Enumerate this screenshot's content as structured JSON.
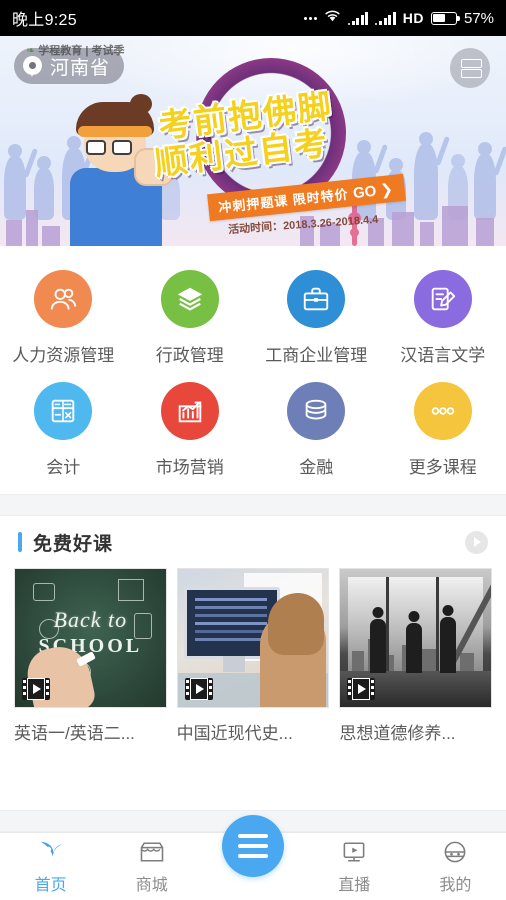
{
  "status_bar": {
    "time": "晚上9:25",
    "hd_label": "HD",
    "battery_percent": "57%",
    "icons": [
      "more-dots-icon",
      "wifi-icon",
      "signal-icon",
      "signal-icon",
      "hd-icon",
      "battery-icon"
    ]
  },
  "banner": {
    "brand_text": "学程教育 | 考试季",
    "location": "河南省",
    "location_icon": "map-pin-icon",
    "scan_icon": "scan-icon",
    "headline_line1": "考前抱佛脚",
    "headline_line2": "顺利过自考",
    "ribbon_text": "冲刺押题课  限时特价",
    "ribbon_cta": "GO ❯",
    "promo_date": "活动时间：2018.3.26-2018.4.4"
  },
  "categories": {
    "rows": [
      [
        {
          "label": "人力资源管理",
          "icon": "people-icon",
          "color": "#F08A50"
        },
        {
          "label": "行政管理",
          "icon": "layers-icon",
          "color": "#77C043"
        },
        {
          "label": "工商企业管理",
          "icon": "briefcase-icon",
          "color": "#2F8FD6"
        },
        {
          "label": "汉语言文学",
          "icon": "note-edit-icon",
          "color": "#8A6BE0"
        }
      ],
      [
        {
          "label": "会计",
          "icon": "calculator-icon",
          "color": "#4FB8EE"
        },
        {
          "label": "市场营销",
          "icon": "chart-growth-icon",
          "color": "#E8483C"
        },
        {
          "label": "金融",
          "icon": "coins-icon",
          "color": "#6E7FB8"
        },
        {
          "label": "更多课程",
          "icon": "more-dots-icon",
          "color": "#F5C53D"
        }
      ]
    ]
  },
  "free_courses": {
    "section_title": "免费好课",
    "more_icon": "chevron-right-icon",
    "accent_color": "#4AA8F0",
    "items": [
      {
        "title": "英语一/英语二...",
        "thumb": "back-to-school-chalkboard",
        "badge_icon": "video-film-icon",
        "chalk_line1": "Back to",
        "chalk_line2": "SCHOOL"
      },
      {
        "title": "中国近现代史...",
        "thumb": "woman-at-computer",
        "badge_icon": "video-film-icon"
      },
      {
        "title": "思想道德修养...",
        "thumb": "people-city-window-bw",
        "badge_icon": "video-film-icon"
      }
    ]
  },
  "bottom_nav": {
    "active_color": "#4AA8F0",
    "items": [
      {
        "label": "首页",
        "icon": "home-star-icon",
        "active": true
      },
      {
        "label": "商城",
        "icon": "shop-icon",
        "active": false
      },
      {
        "label": "直播",
        "icon": "live-play-icon",
        "active": false
      },
      {
        "label": "我的",
        "icon": "profile-face-icon",
        "active": false
      }
    ],
    "center_button": {
      "icon": "menu-hamburger-icon",
      "label": ""
    }
  }
}
